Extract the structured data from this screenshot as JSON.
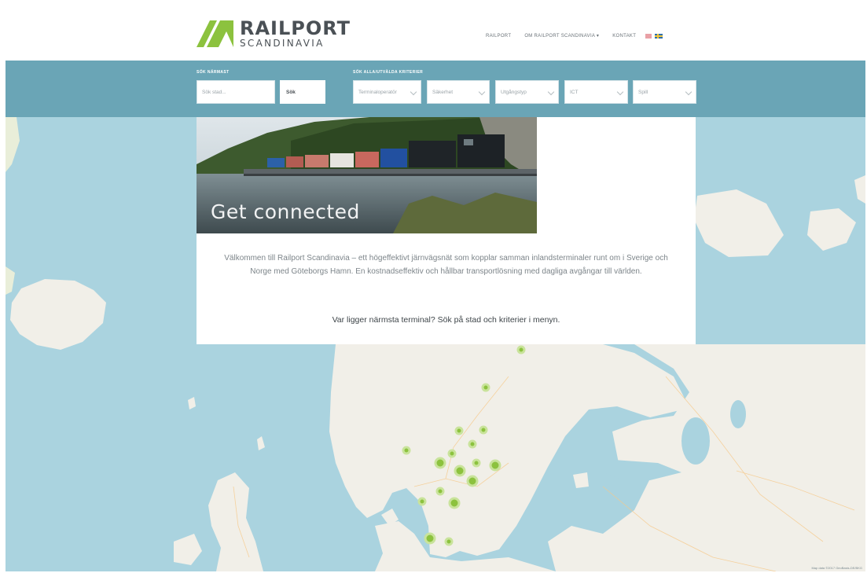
{
  "header": {
    "logo_line1": "RAILPORT",
    "logo_line2": "SCANDINAVIA",
    "nav": [
      "RAILPORT",
      "OM RAILPORT SCANDINAVIA ▾",
      "KONTAKT"
    ],
    "flags": [
      "norway-flag-icon",
      "sweden-flag-icon"
    ]
  },
  "search": {
    "city_label": "SÖK NÄRMAST",
    "city_placeholder": "Sök stad...",
    "search_button": "Sök",
    "criteria_label": "SÖK ALLA/UTVÄLDA KRITERIER",
    "filters": [
      "Terminaloperatör",
      "Säkerhet",
      "Utgångstyp",
      "ICT",
      "Spill"
    ]
  },
  "hero": {
    "caption": "Get connected"
  },
  "intro": {
    "text": "Välkommen till Railport Scandinavia – ett högeffektivt järnvägsnät som kopplar samman inlandsterminaler runt om i Sverige och Norge med Göteborgs Hamn. En kostnadseffektiv och hållbar transportlösning med dagliga avgångar till världen.",
    "cta": "Var ligger närmsta terminal? Sök på stad och kriterier i menyn."
  },
  "map": {
    "attribution": "Map data ©2017 GeoBasis-DE/BKG",
    "marker_count": 22
  },
  "colors": {
    "accent_green": "#8cc23e",
    "band_teal": "#6aa5b6",
    "water": "#aad3df",
    "land": "#f1efe8"
  }
}
